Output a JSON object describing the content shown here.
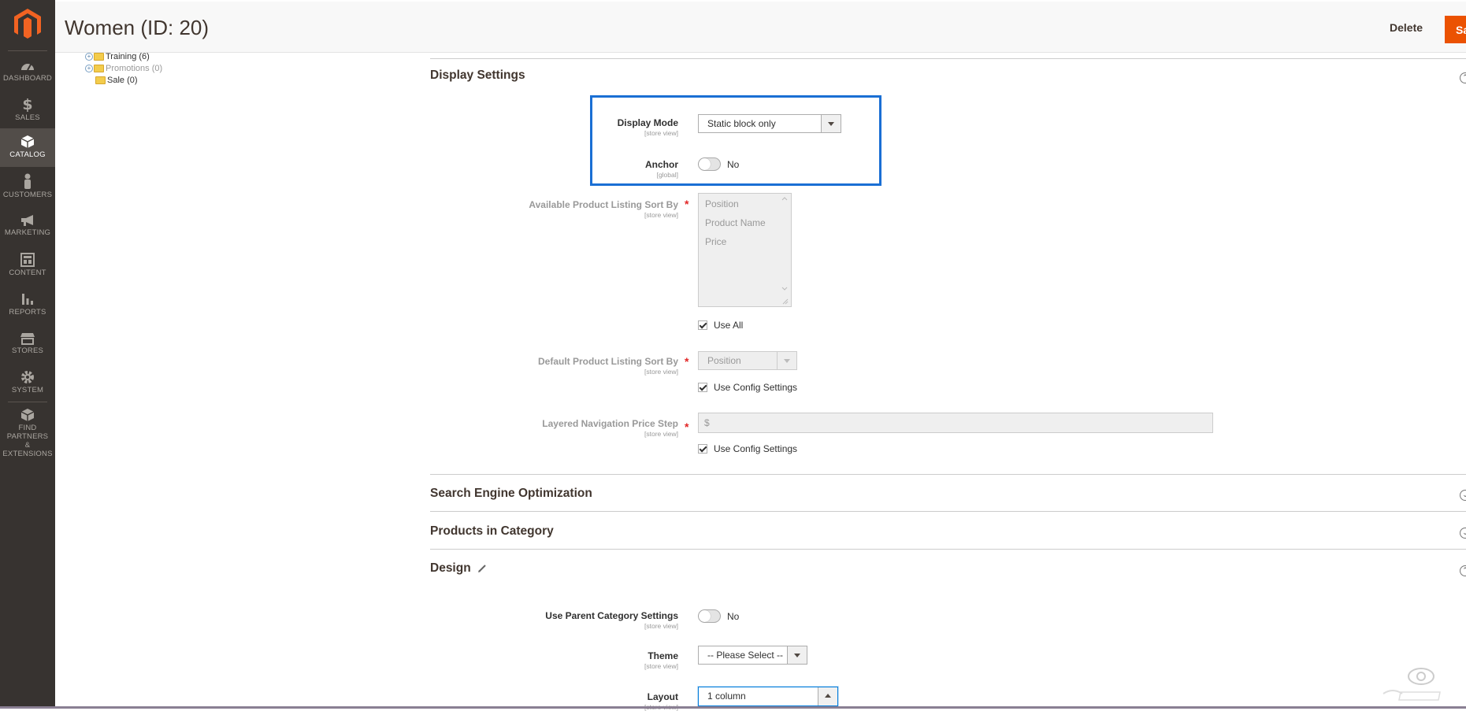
{
  "sidebar": {
    "items": [
      {
        "label": "DASHBOARD",
        "icon": "dashboard-icon"
      },
      {
        "label": "SALES",
        "icon": "dollar-icon"
      },
      {
        "label": "CATALOG",
        "icon": "cube-icon",
        "active": true
      },
      {
        "label": "CUSTOMERS",
        "icon": "person-icon"
      },
      {
        "label": "MARKETING",
        "icon": "megaphone-icon"
      },
      {
        "label": "CONTENT",
        "icon": "layout-icon"
      },
      {
        "label": "REPORTS",
        "icon": "bar-chart-icon"
      },
      {
        "label": "STORES",
        "icon": "storefront-icon"
      },
      {
        "label": "SYSTEM",
        "icon": "gear-icon"
      },
      {
        "label_line1": "FIND PARTNERS",
        "label_line2": "& EXTENSIONS",
        "icon": "box-icon"
      }
    ]
  },
  "header": {
    "title": "Women (ID: 20)",
    "delete_label": "Delete",
    "save_label": "Save"
  },
  "tree": {
    "items": [
      {
        "label": "Training (6)",
        "expandable": true,
        "muted": false
      },
      {
        "label": "Promotions (0)",
        "expandable": true,
        "muted": true
      },
      {
        "label": "Sale (0)",
        "expandable": false,
        "muted": false
      }
    ]
  },
  "display_settings": {
    "title": "Display Settings",
    "display_mode": {
      "label": "Display Mode",
      "scope": "[store view]",
      "value": "Static block only"
    },
    "anchor": {
      "label": "Anchor",
      "scope": "[global]",
      "value": "No"
    },
    "available_sort": {
      "label": "Available Product Listing Sort By",
      "scope": "[store view]",
      "options": [
        "Position",
        "Product Name",
        "Price"
      ],
      "use_all_label": "Use All"
    },
    "default_sort": {
      "label": "Default Product Listing Sort By",
      "scope": "[store view]",
      "value": "Position",
      "use_config_label": "Use Config Settings"
    },
    "price_step": {
      "label": "Layered Navigation Price Step",
      "scope": "[store view]",
      "prefix": "$",
      "use_config_label": "Use Config Settings"
    }
  },
  "sections": {
    "seo": "Search Engine Optimization",
    "products": "Products in Category",
    "design": "Design"
  },
  "design": {
    "use_parent": {
      "label": "Use Parent Category Settings",
      "scope": "[store view]",
      "value": "No"
    },
    "theme": {
      "label": "Theme",
      "scope": "[store view]",
      "value": "-- Please Select --"
    },
    "layout": {
      "label": "Layout",
      "scope": "[store view]",
      "value": "1 column"
    }
  },
  "required_mark": "*",
  "colors": {
    "accent": "#eb5202",
    "sidebar": "#373330",
    "highlight": "#1a6fd4"
  }
}
